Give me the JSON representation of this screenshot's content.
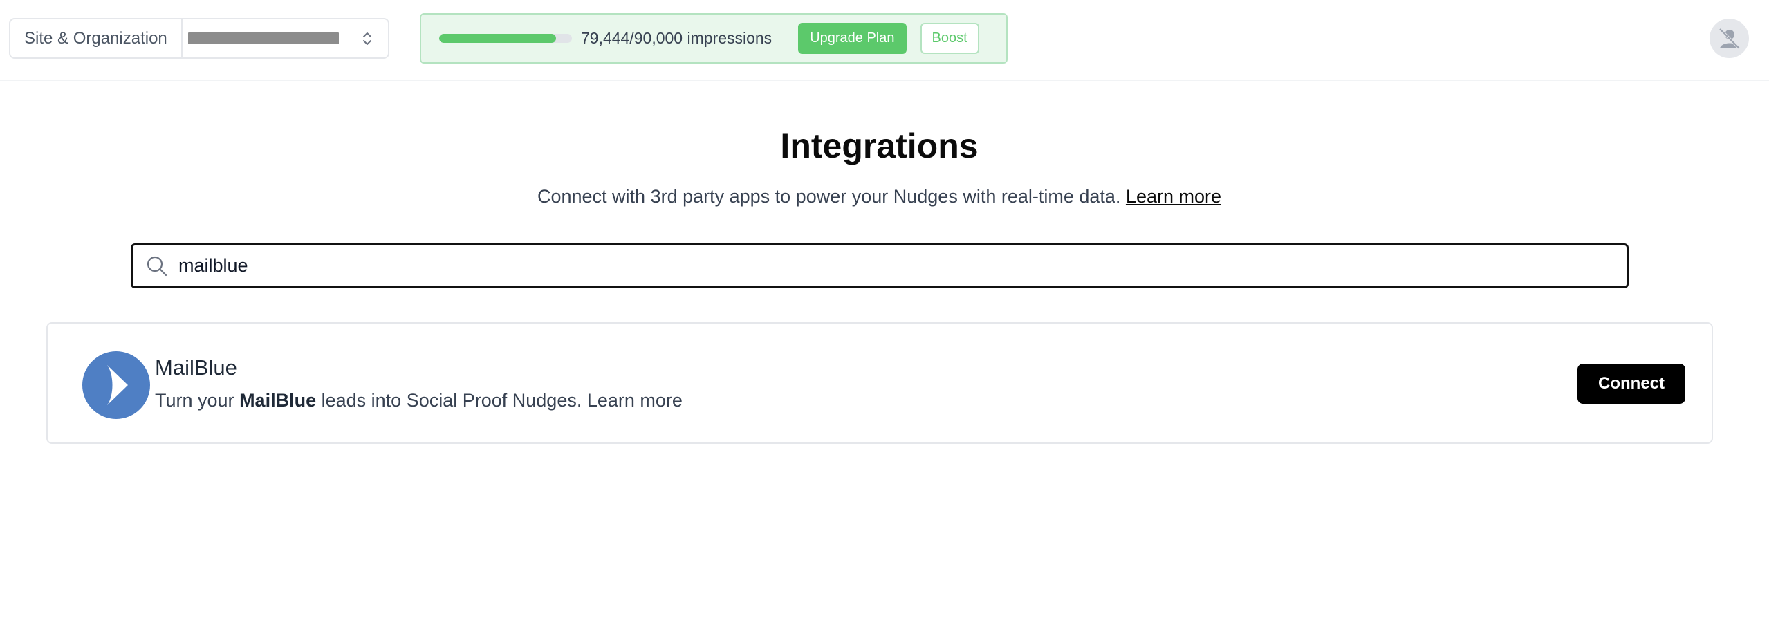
{
  "header": {
    "site_selector": {
      "label": "Site & Organization"
    },
    "usage": {
      "impressions_text": "79,444/90,000 impressions",
      "used": 79444,
      "limit": 90000,
      "upgrade_label": "Upgrade Plan",
      "boost_label": "Boost",
      "accent_color": "#5cc96b"
    },
    "avatar_icon": "user-hidden-icon"
  },
  "main": {
    "title": "Integrations",
    "subtitle": "Connect with 3rd party apps to power your Nudges with real-time data.",
    "learn_more": "Learn more",
    "search": {
      "value": "mailblue",
      "icon": "search-icon"
    },
    "integrations": [
      {
        "name": "MailBlue",
        "desc_prefix": "Turn your",
        "desc_brand": "MailBlue",
        "desc_suffix": "leads into Social Proof Nudges.",
        "learn_more": "Learn more",
        "connect_label": "Connect",
        "logo_color": "#4f7fc4"
      }
    ]
  }
}
